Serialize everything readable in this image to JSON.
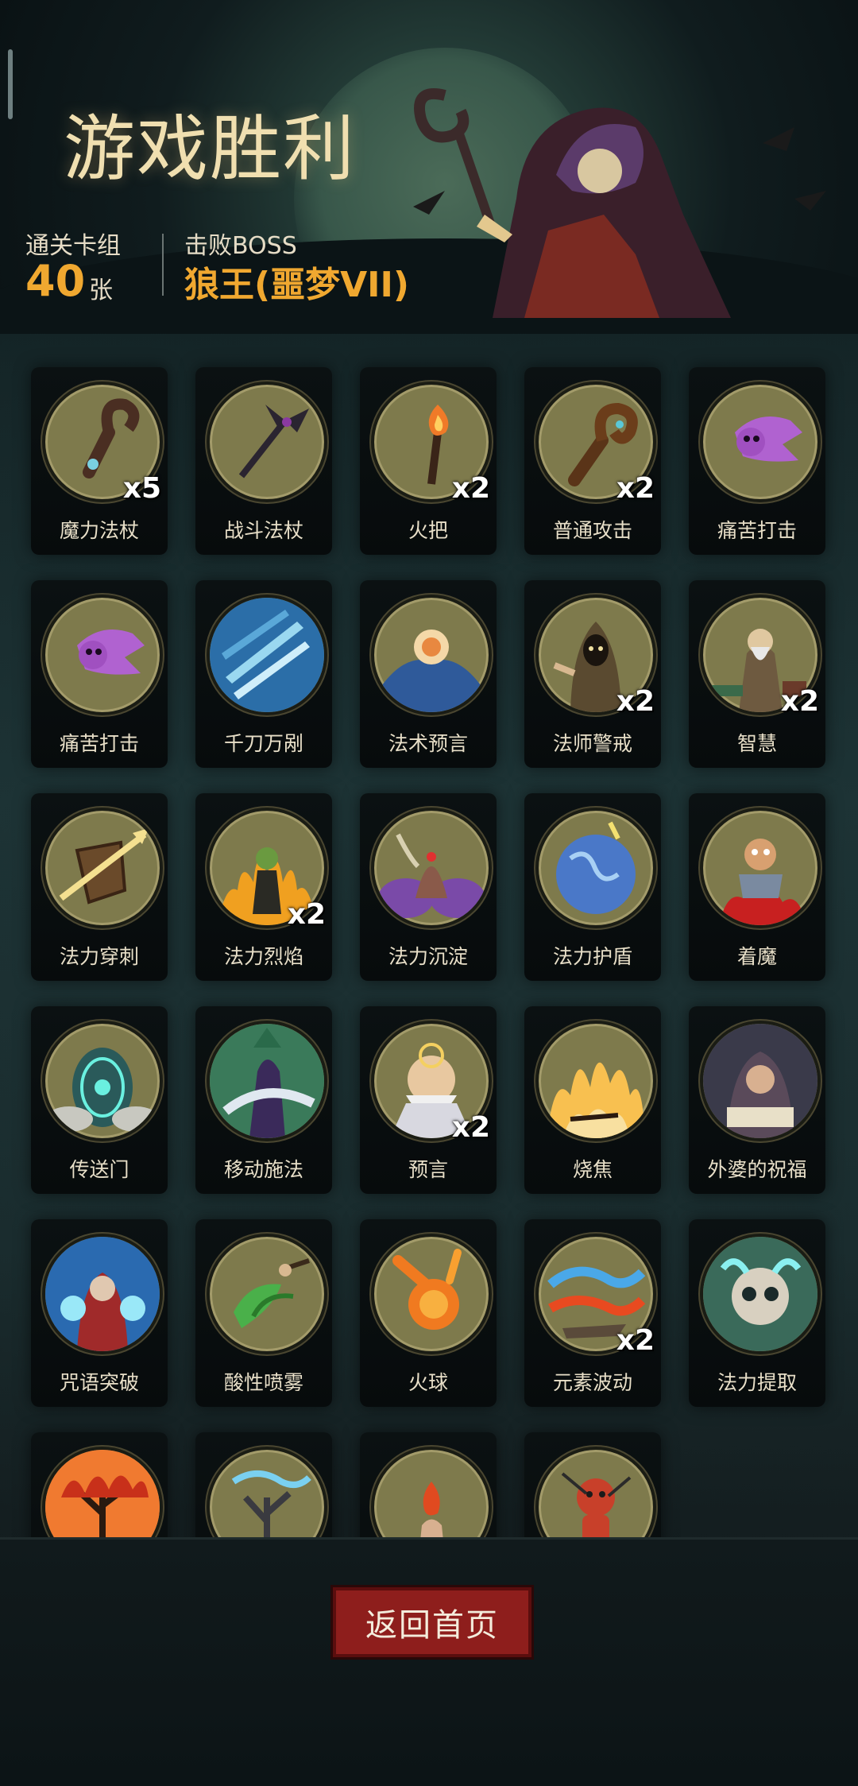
{
  "header": {
    "title": "游戏胜利",
    "clear_deck_label": "通关卡组",
    "clear_deck_count": "40",
    "clear_deck_unit": "张",
    "boss_label": "击败BOSS",
    "boss_name": "狼王(噩梦VII)"
  },
  "cards": [
    {
      "name": "魔力法杖",
      "count": "x5",
      "icon": "magic-staff"
    },
    {
      "name": "战斗法杖",
      "count": "",
      "icon": "battle-staff"
    },
    {
      "name": "火把",
      "count": "x2",
      "icon": "torch"
    },
    {
      "name": "普通攻击",
      "count": "x2",
      "icon": "crook-staff"
    },
    {
      "name": "痛苦打击",
      "count": "",
      "icon": "pain-strike"
    },
    {
      "name": "痛苦打击",
      "count": "",
      "icon": "pain-strike"
    },
    {
      "name": "千刀万剐",
      "count": "",
      "icon": "blades"
    },
    {
      "name": "法术预言",
      "count": "",
      "icon": "orb-prophecy"
    },
    {
      "name": "法师警戒",
      "count": "x2",
      "icon": "hooded-mage"
    },
    {
      "name": "智慧",
      "count": "x2",
      "icon": "sage"
    },
    {
      "name": "法力穿刺",
      "count": "",
      "icon": "shield-pierce"
    },
    {
      "name": "法力烈焰",
      "count": "x2",
      "icon": "flame-figure"
    },
    {
      "name": "法力沉淀",
      "count": "",
      "icon": "purple-mist"
    },
    {
      "name": "法力护盾",
      "count": "",
      "icon": "mana-shield"
    },
    {
      "name": "着魔",
      "count": "",
      "icon": "possessed"
    },
    {
      "name": "传送门",
      "count": "",
      "icon": "portal"
    },
    {
      "name": "移动施法",
      "count": "",
      "icon": "moving-cast"
    },
    {
      "name": "预言",
      "count": "x2",
      "icon": "old-prophet"
    },
    {
      "name": "烧焦",
      "count": "",
      "icon": "scorch"
    },
    {
      "name": "外婆的祝福",
      "count": "",
      "icon": "grandma"
    },
    {
      "name": "咒语突破",
      "count": "",
      "icon": "spell-break"
    },
    {
      "name": "酸性喷雾",
      "count": "",
      "icon": "acid-spray"
    },
    {
      "name": "火球",
      "count": "",
      "icon": "fireball"
    },
    {
      "name": "元素波动",
      "count": "x2",
      "icon": "element-wave"
    },
    {
      "name": "法力提取",
      "count": "",
      "icon": "skull"
    },
    {
      "name": "",
      "count": "",
      "icon": "burning-tree"
    },
    {
      "name": "",
      "count": "",
      "icon": "storm-tree"
    },
    {
      "name": "",
      "count": "",
      "icon": "fire-hand"
    },
    {
      "name": "",
      "count": "",
      "icon": "voodoo-doll"
    }
  ],
  "footer": {
    "home_button": "返回首页"
  },
  "colors": {
    "accent_orange": "#f0a830",
    "title_cream": "#f0dfb0",
    "button_red": "#8e1e1c",
    "emblem_olive": "#7e7a4c"
  }
}
